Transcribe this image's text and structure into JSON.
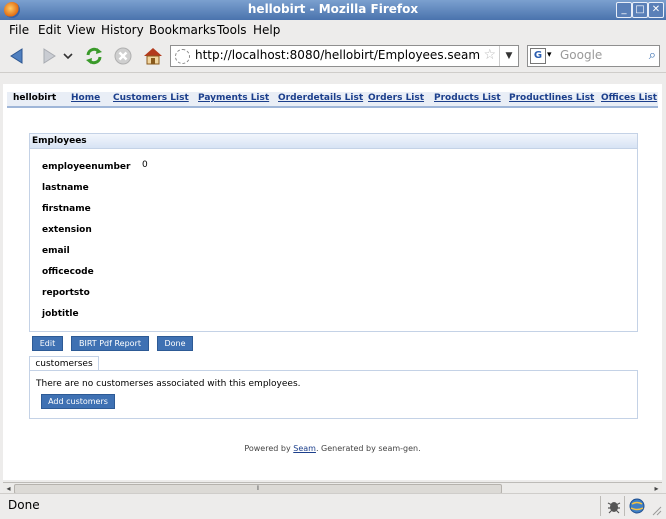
{
  "window": {
    "title": "hellobirt - Mozilla Firefox"
  },
  "menubar": [
    {
      "label": "File"
    },
    {
      "label": "Edit"
    },
    {
      "label": "View"
    },
    {
      "label": "History"
    },
    {
      "label": "Bookmarks"
    },
    {
      "label": "Tools"
    },
    {
      "label": "Help"
    }
  ],
  "navbar": {
    "url": "http://localhost:8080/hellobirt/Employees.seam",
    "search_placeholder": "Google",
    "search_engine": "G",
    "icons": [
      "back-arrow-icon",
      "forward-arrow-icon",
      "history-dropdown-icon",
      "reload-icon",
      "stop-icon",
      "home-icon"
    ]
  },
  "site_nav": {
    "brand": "hellobirt",
    "links": [
      {
        "label": "Home"
      },
      {
        "label": "Customers List"
      },
      {
        "label": "Payments List"
      },
      {
        "label": "Orderdetails List"
      },
      {
        "label": "Orders List"
      },
      {
        "label": "Products List"
      },
      {
        "label": "Productlines List"
      },
      {
        "label": "Offices List"
      }
    ]
  },
  "employee_panel": {
    "header": "Employees",
    "fields": [
      {
        "label": "employeenumber",
        "value": "0"
      },
      {
        "label": "lastname",
        "value": ""
      },
      {
        "label": "firstname",
        "value": ""
      },
      {
        "label": "extension",
        "value": ""
      },
      {
        "label": "email",
        "value": ""
      },
      {
        "label": "officecode",
        "value": ""
      },
      {
        "label": "reportsto",
        "value": ""
      },
      {
        "label": "jobtitle",
        "value": ""
      }
    ]
  },
  "actions": {
    "edit": "Edit",
    "birt_report": "BIRT Pdf Report",
    "done": "Done"
  },
  "customers_tab": {
    "tab_label": "customerses",
    "message": "There are no customerses associated with this employees.",
    "add_button": "Add customers"
  },
  "footer": {
    "prefix": "Powered by",
    "link": "Seam",
    "suffix": ". Generated by seam-gen."
  },
  "status": {
    "text": "Done"
  }
}
